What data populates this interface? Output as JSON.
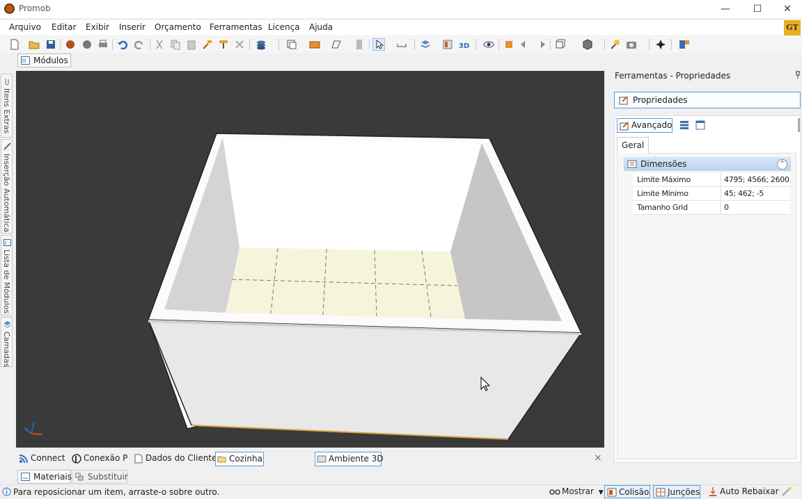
{
  "window": {
    "title": "Promob",
    "minimize": "—",
    "maximize": "☐",
    "close": "✕"
  },
  "menu": [
    "Arquivo",
    "Editar",
    "Exibir",
    "Inserir",
    "Orçamento",
    "Ferramentas",
    "Licença",
    "Ajuda"
  ],
  "badge": "GT",
  "modulos_tab": "Módulos",
  "side_tabs": [
    "Itens Extras",
    "Inserção Automática",
    "Lista de Módulos",
    "Camadas"
  ],
  "bottom_tabs": {
    "connect": "Connect",
    "conexao": "Conexão P",
    "dados": "Dados do Cliente",
    "cozinha": "Cozinha",
    "ambiente": "Ambiente 3D",
    "close": "×"
  },
  "lower_tabs": [
    "Materiais",
    "Substituir"
  ],
  "status": {
    "hint": "Para reposicionar um item, arraste-o sobre outro.",
    "mostrar": "Mostrar",
    "colisao": "Colisão",
    "juncoes": "Junções",
    "auto_rebaixar": "Auto Rebaixar"
  },
  "panel": {
    "title": "Ferramentas - Propriedades",
    "properties": "Propriedades",
    "advanced": "Avançado",
    "tab": "Geral",
    "section": "Dimensões",
    "rows": [
      {
        "label": "Limite Máximo",
        "value": "4795; 4566; 2600"
      },
      {
        "label": "Limite Mínimo",
        "value": "45; 462; -5"
      },
      {
        "label": "Tamanho Grid",
        "value": "0"
      }
    ]
  },
  "colors": {
    "viewport": "#3a3a3a",
    "floor": "#f7f4dc",
    "wall": "#e8e8e8",
    "accent": "#5a9bd8"
  }
}
